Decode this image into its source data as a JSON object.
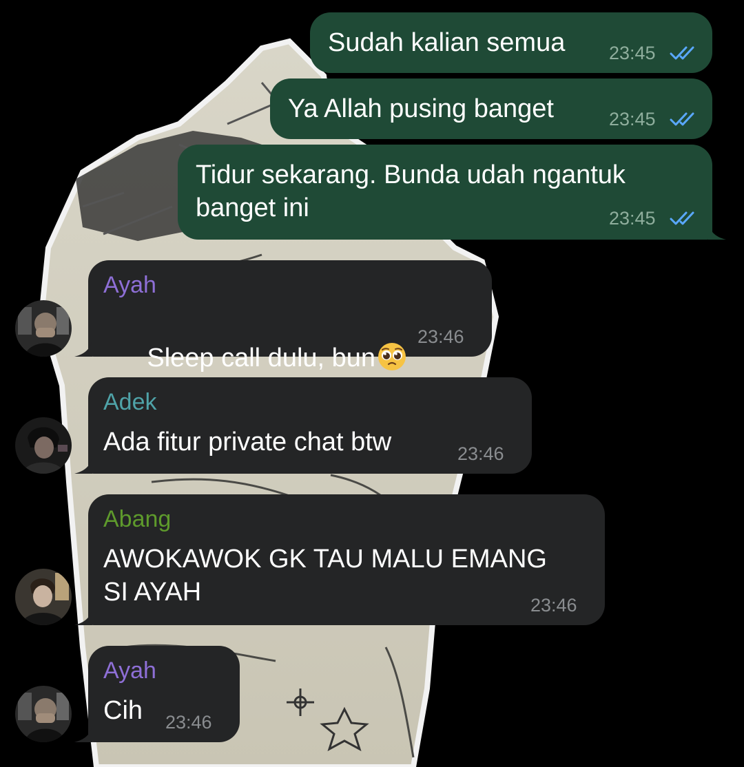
{
  "colors": {
    "background": "#000000",
    "outgoing_bubble": "#1f4a36",
    "incoming_bubble": "#242526",
    "read_check": "#5aa8ff",
    "name_ayah": "#8e6fd6",
    "name_adek": "#4fa3a8",
    "name_abang": "#5e9a2c"
  },
  "messages": [
    {
      "direction": "outgoing",
      "text": "Sudah kalian semua",
      "time": "23:45",
      "status_icon": "double-check-icon"
    },
    {
      "direction": "outgoing",
      "text": "Ya Allah pusing banget",
      "time": "23:45",
      "status_icon": "double-check-icon"
    },
    {
      "direction": "outgoing",
      "text": "Tidur sekarang. Bunda udah ngantuk\nbanget ini",
      "time": "23:45",
      "status_icon": "double-check-icon"
    },
    {
      "direction": "incoming",
      "sender": "Ayah",
      "text": "Sleep call dulu, bun",
      "emoji": "pleading-face-emoji",
      "time": "23:46",
      "avatar": "avatar-ayah"
    },
    {
      "direction": "incoming",
      "sender": "Adek",
      "text": "Ada fitur private chat btw",
      "time": "23:46",
      "avatar": "avatar-adek"
    },
    {
      "direction": "incoming",
      "sender": "Abang",
      "text": "AWOKAWOK GK TAU MALU EMANG\nSI AYAH",
      "time": "23:46",
      "avatar": "avatar-abang"
    },
    {
      "direction": "incoming",
      "sender": "Ayah",
      "text": "Cih",
      "time": "23:46",
      "avatar": "avatar-ayah"
    }
  ]
}
